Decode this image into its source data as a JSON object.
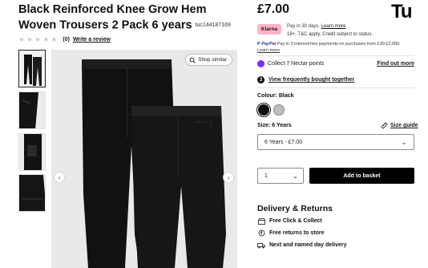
{
  "product": {
    "title": "Black Reinforced Knee Grow Hem Woven Trousers 2 Pack 6 years",
    "code": "tuc144187169",
    "review_count": "(0)",
    "write_review": "Write a review",
    "star_count": 5
  },
  "gallery": {
    "shop_similar": "Shop similar",
    "thumb_count": 4
  },
  "brand": {
    "logo": "Tu"
  },
  "pricing": {
    "price": "£7.00",
    "klarna_badge": "Klarna",
    "klarna_line1": "Pay in 30 days.",
    "klarna_learn": "Learn more",
    "klarna_line2": "18+, T&C apply, Credit subject to status.",
    "paypal_brand": "PayPal",
    "paypal_line": "Pay in 3 interest-free payments on purchases from £30-£2,000.",
    "paypal_learn": "Learn more"
  },
  "nectar": {
    "text": "Collect 7 Nectar points",
    "link": "Find out more"
  },
  "fbt": {
    "number": "3",
    "text": "View frequently bought together"
  },
  "colour": {
    "label": "Colour: Black",
    "options": [
      "Black",
      "Grey"
    ],
    "selected": "Black"
  },
  "size": {
    "label": "Size: 6 Years",
    "guide": "Size guide",
    "selected": "6 Years - £7.00"
  },
  "quantity": {
    "value": "1"
  },
  "basket_button": "Add to basket",
  "delivery": {
    "title": "Delivery & Returns",
    "items": [
      "Free Click & Collect",
      "Free returns to store",
      "Next and named day delivery"
    ]
  },
  "colors": {
    "klarna_pink": "#ffb3c7",
    "nectar_purple": "#7b2ff7",
    "button_black": "#000000"
  }
}
